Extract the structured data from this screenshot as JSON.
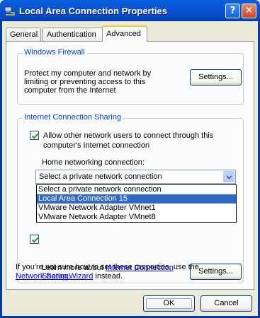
{
  "window": {
    "title": "Local Area Connection Properties",
    "help_glyph": "?",
    "close_glyph": "✕"
  },
  "tabs": [
    {
      "label": "General"
    },
    {
      "label": "Authentication"
    },
    {
      "label": "Advanced",
      "selected": true
    }
  ],
  "firewall": {
    "title": "Windows Firewall",
    "text": "Protect my computer and network by limiting or preventing access to this computer from the Internet",
    "settings_label": "Settings..."
  },
  "ics": {
    "title": "Internet Connection Sharing",
    "allow_label": "Allow other network users to connect through this computer's Internet connection",
    "allow_checked": true,
    "second_checked": true,
    "home_label": "Home networking connection:",
    "select_value": "Select a private network connection",
    "options": [
      "Select a private network connection",
      "Local Area Connection 15",
      "VMware Network Adapter VMnet1",
      "VMware Network Adapter VMnet8"
    ],
    "highlighted_index": 1,
    "learn_prefix": "Learn more about ",
    "learn_link": "Internet Connection Sharing",
    "learn_suffix": ".",
    "settings_label": "Settings..."
  },
  "footer": {
    "text_prefix": "If you're not sure how to set these properties, use the ",
    "wizard_link": "Network Setup Wizard",
    "text_suffix": " instead."
  },
  "buttons": {
    "ok": "OK",
    "cancel": "Cancel"
  },
  "colors": {
    "titlebar": "#0B55D4",
    "group_title": "#0046D5",
    "highlight": "#316AC5",
    "link": "#0000FF"
  }
}
